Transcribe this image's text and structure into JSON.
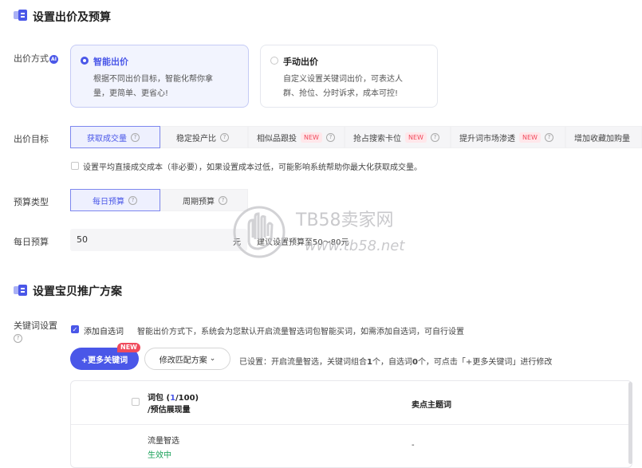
{
  "section1": {
    "title": "设置出价及预算"
  },
  "bid_method": {
    "label": "出价方式",
    "ai_badge": "AI",
    "options": [
      {
        "title": "智能出价",
        "desc_line1": "根据不同出价目标，智能化帮你拿",
        "desc_line2": "量，更简单、更省心!",
        "selected": true
      },
      {
        "title": "手动出价",
        "desc_line1": "自定义设置关键词出价，可表达人",
        "desc_line2": "群、抢位、分时诉求，成本可控!",
        "selected": false
      }
    ]
  },
  "bid_target": {
    "label": "出价目标",
    "options": [
      {
        "label": "获取成交量",
        "help": "?",
        "new": "",
        "selected": true
      },
      {
        "label": "稳定投产比",
        "help": "?",
        "new": "",
        "selected": false
      },
      {
        "label": "相似品跟投",
        "help": "?",
        "new": "NEW",
        "selected": false
      },
      {
        "label": "抢占搜索卡位",
        "help": "?",
        "new": "NEW",
        "selected": false
      },
      {
        "label": "提升词市场渗透",
        "help": "?",
        "new": "NEW",
        "selected": false
      },
      {
        "label": "增加收藏加购量",
        "help": "",
        "new": "",
        "selected": false
      }
    ],
    "cost_checkbox_text": "设置平均直接成交成本（非必要），如果设置成本过低，可能影响系统帮助你最大化获取成交量。"
  },
  "budget_type": {
    "label": "预算类型",
    "options": [
      {
        "label": "每日预算",
        "help": "?",
        "selected": true
      },
      {
        "label": "周期预算",
        "help": "?",
        "selected": false
      }
    ]
  },
  "daily_budget": {
    "label": "每日预算",
    "value": "50",
    "unit": "元",
    "hint": "建议设置预算至50～80元"
  },
  "watermark": {
    "brand": "TB58卖家网",
    "url": "www.tb58.net"
  },
  "section2": {
    "title": "设置宝贝推广方案"
  },
  "keyword": {
    "label": "关键词设置",
    "help": "?",
    "add_auto_label": "添加自选词",
    "add_auto_desc": "智能出价方式下，系统会为您默认开启流量智选词包智能买词，如需添加自选词，可自行设置",
    "more_btn": "+更多关键词",
    "more_btn_badge": "NEW",
    "modify_btn": "修改匹配方案",
    "chevron": "⌄",
    "summary_prefix": "已设置：开启流量智选，关键词组合",
    "summary_count1": "1",
    "summary_mid": "个，自选词",
    "summary_count2": "0",
    "summary_suffix": "个，可点击「+更多关键词」进行修改"
  },
  "table": {
    "col1_prefix": "词包 (",
    "col1_count": "1",
    "col1_total": "/100)",
    "col1_line2": "/预估展现量",
    "col2": "卖点主题词",
    "row": {
      "name": "流量智选",
      "status": "生效中",
      "theme": "-"
    },
    "colors": {
      "status": "#18a058"
    }
  },
  "colors": {
    "accent": "#4a57e8",
    "new_tag": "#f04a5c"
  }
}
